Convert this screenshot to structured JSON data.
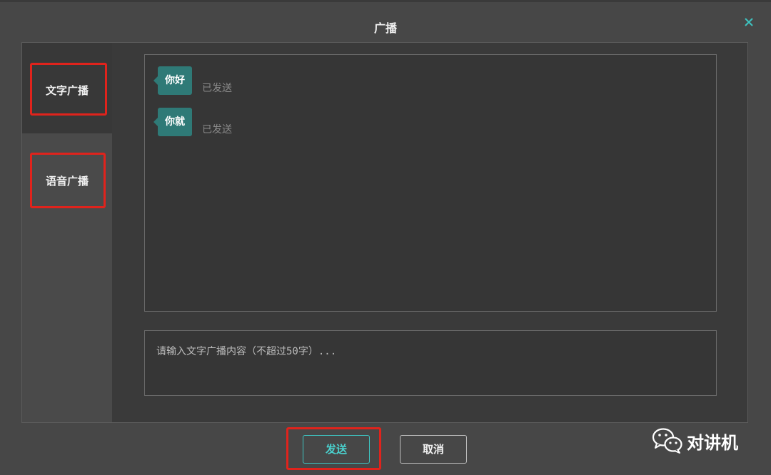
{
  "dialog": {
    "title": "广播",
    "close_icon": "close-icon"
  },
  "sidebar": {
    "tabs": [
      {
        "label": "文字广播",
        "active": true
      },
      {
        "label": "语音广播",
        "active": false
      }
    ]
  },
  "messages": [
    {
      "text": "你好",
      "status": "已发送"
    },
    {
      "text": "你就",
      "status": "已发送"
    }
  ],
  "input": {
    "placeholder": "请输入文字广播内容（不超过50字）...",
    "value": ""
  },
  "buttons": {
    "send": "发送",
    "cancel": "取消"
  },
  "watermark": {
    "icon": "wechat-icon",
    "text": "对讲机"
  },
  "colors": {
    "accent": "#3ec3c0",
    "bubble": "#2f7a77",
    "highlight": "#e0231c"
  }
}
